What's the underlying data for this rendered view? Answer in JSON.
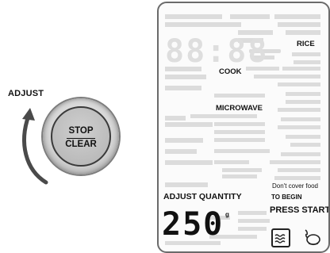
{
  "controls": {
    "adjust_label": "ADJUST",
    "stop_label": "STOP",
    "clear_label": "CLEAR"
  },
  "display": {
    "active_labels": {
      "rice": "RICE",
      "cook": "COOK",
      "microwave": "MICROWAVE",
      "dont_cover": "Don't cover food",
      "adjust_quantity": "ADJUST QUANTITY",
      "to_begin": "TO BEGIN",
      "press_start": "PRESS START"
    },
    "quantity_value": "250",
    "quantity_unit": "g",
    "icons": {
      "steam": "steam-icon",
      "chicken": "chicken-icon"
    }
  }
}
